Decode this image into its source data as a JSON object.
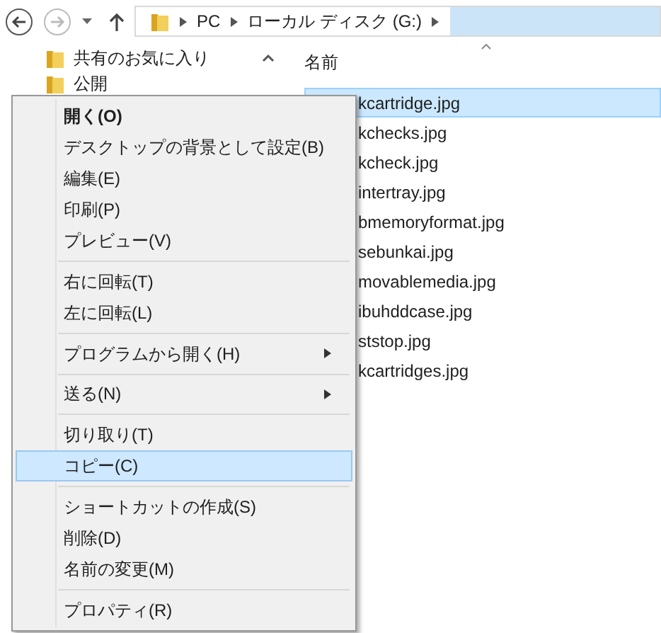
{
  "toolbar": {
    "address": {
      "segments": [
        "PC",
        "ローカル ディスク (G:)"
      ]
    }
  },
  "sidebar": {
    "items": [
      {
        "label": "共有のお気に入り"
      },
      {
        "label": "公開"
      }
    ]
  },
  "file_list": {
    "column": "名前",
    "files": [
      {
        "name": "kcartridge.jpg",
        "selected": true
      },
      {
        "name": "kchecks.jpg",
        "selected": false
      },
      {
        "name": "kcheck.jpg",
        "selected": false
      },
      {
        "name": "intertray.jpg",
        "selected": false
      },
      {
        "name": "bmemoryformat.jpg",
        "selected": false
      },
      {
        "name": "sebunkai.jpg",
        "selected": false
      },
      {
        "name": "movablemedia.jpg",
        "selected": false
      },
      {
        "name": "ibuhddcase.jpg",
        "selected": false
      },
      {
        "name": "ststop.jpg",
        "selected": false
      },
      {
        "name": "kcartridges.jpg",
        "selected": false
      }
    ]
  },
  "context_menu": {
    "items": [
      {
        "kind": "item",
        "label": "開く(O)",
        "default": true,
        "submenu": false,
        "selected": false
      },
      {
        "kind": "item",
        "label": "デスクトップの背景として設定(B)",
        "default": false,
        "submenu": false,
        "selected": false
      },
      {
        "kind": "item",
        "label": "編集(E)",
        "default": false,
        "submenu": false,
        "selected": false
      },
      {
        "kind": "item",
        "label": "印刷(P)",
        "default": false,
        "submenu": false,
        "selected": false
      },
      {
        "kind": "item",
        "label": "プレビュー(V)",
        "default": false,
        "submenu": false,
        "selected": false
      },
      {
        "kind": "separator"
      },
      {
        "kind": "item",
        "label": "右に回転(T)",
        "default": false,
        "submenu": false,
        "selected": false
      },
      {
        "kind": "item",
        "label": "左に回転(L)",
        "default": false,
        "submenu": false,
        "selected": false
      },
      {
        "kind": "separator"
      },
      {
        "kind": "item",
        "label": "プログラムから開く(H)",
        "default": false,
        "submenu": true,
        "selected": false
      },
      {
        "kind": "separator"
      },
      {
        "kind": "item",
        "label": "送る(N)",
        "default": false,
        "submenu": true,
        "selected": false
      },
      {
        "kind": "separator"
      },
      {
        "kind": "item",
        "label": "切り取り(T)",
        "default": false,
        "submenu": false,
        "selected": false
      },
      {
        "kind": "item",
        "label": "コピー(C)",
        "default": false,
        "submenu": false,
        "selected": true
      },
      {
        "kind": "separator"
      },
      {
        "kind": "item",
        "label": "ショートカットの作成(S)",
        "default": false,
        "submenu": false,
        "selected": false
      },
      {
        "kind": "item",
        "label": "削除(D)",
        "default": false,
        "submenu": false,
        "selected": false
      },
      {
        "kind": "item",
        "label": "名前の変更(M)",
        "default": false,
        "submenu": false,
        "selected": false
      },
      {
        "kind": "separator"
      },
      {
        "kind": "item",
        "label": "プロパティ(R)",
        "default": false,
        "submenu": false,
        "selected": false
      }
    ]
  }
}
